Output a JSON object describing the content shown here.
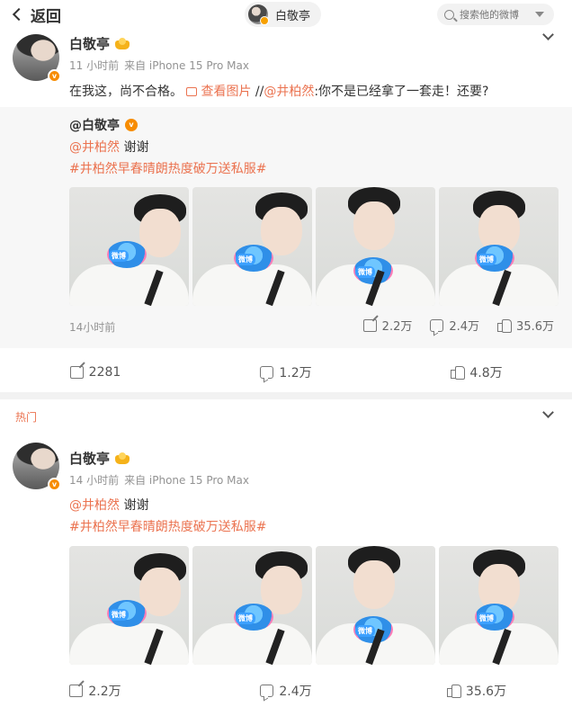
{
  "header": {
    "back_label": "返回",
    "user_pill": "白敬亭",
    "search_placeholder": "搜索他的微博"
  },
  "post1": {
    "author": "白敬亭",
    "time": "11 小时前",
    "source": "来自 iPhone 15 Pro Max",
    "text_main": "在我这，尚不合格。",
    "view_image": "查看图片",
    "slashes": " //",
    "mention": "@井柏然",
    "quote": ":你不是已经拿了一套走！还要?",
    "repost": {
      "author": "@白敬亭",
      "mention": "@井柏然",
      "text": " 谢谢",
      "topic": "#井柏然早春晴朗热度破万送私服#",
      "time": "14小时前",
      "shares": "2.2万",
      "comments": "2.4万",
      "likes": "35.6万"
    },
    "actions": {
      "shares": "2281",
      "comments": "1.2万",
      "likes": "4.8万"
    }
  },
  "hot_label": "热门",
  "post2": {
    "author": "白敬亭",
    "time": "14 小时前",
    "source": "来自 iPhone 15 Pro Max",
    "mention": "@井柏然",
    "text": " 谢谢",
    "topic": "#井柏然早春晴朗热度破万送私服#",
    "actions": {
      "shares": "2.2万",
      "comments": "2.4万",
      "likes": "35.6万"
    }
  },
  "icons": {
    "back": "chevron-left-icon",
    "search": "search-icon",
    "menu": "chevron-down-icon",
    "share": "share-icon",
    "comment": "comment-icon",
    "like": "thumbs-up-icon"
  },
  "colors": {
    "accent": "#eb7350",
    "verified": "#f78c00",
    "muted": "#939393",
    "repost_bg": "#f7f7f7"
  }
}
